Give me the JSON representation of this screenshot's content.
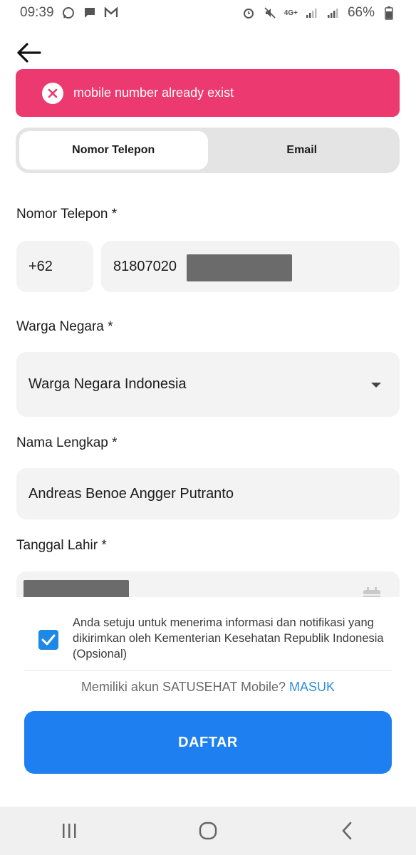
{
  "status_bar": {
    "time": "09:39",
    "network": "4G+",
    "battery": "66%",
    "icons": [
      "whatsapp-icon",
      "message-icon",
      "gmail-icon",
      "alarm-icon",
      "mute-icon",
      "signal-icon",
      "battery-icon"
    ]
  },
  "error": {
    "message": "mobile number already exist",
    "color": "#ec3a70"
  },
  "tabs": [
    {
      "label": "Nomor Telepon",
      "active": true
    },
    {
      "label": "Email",
      "active": false
    }
  ],
  "form": {
    "phone": {
      "label": "Nomor Telepon *",
      "country_code": "+62",
      "value": "81807020"
    },
    "citizenship": {
      "label": "Warga Negara *",
      "selected": "Warga Negara Indonesia"
    },
    "full_name": {
      "label": "Nama Lengkap *",
      "value": "Andreas Benoe Angger Putranto"
    },
    "birth_date": {
      "label": "Tanggal Lahir *",
      "value": ""
    }
  },
  "consent": {
    "checked": true,
    "text": "Anda setuju untuk menerima informasi dan notifikasi yang dikirimkan oleh Kementerian Kesehatan Republik Indonesia (Opsional)"
  },
  "login_prompt": {
    "text": "Memiliki akun SATUSEHAT Mobile?",
    "link": "MASUK"
  },
  "submit_label": "DAFTAR",
  "colors": {
    "accent": "#1e7ff0",
    "link": "#2f8fdc",
    "error": "#ec3a70"
  }
}
